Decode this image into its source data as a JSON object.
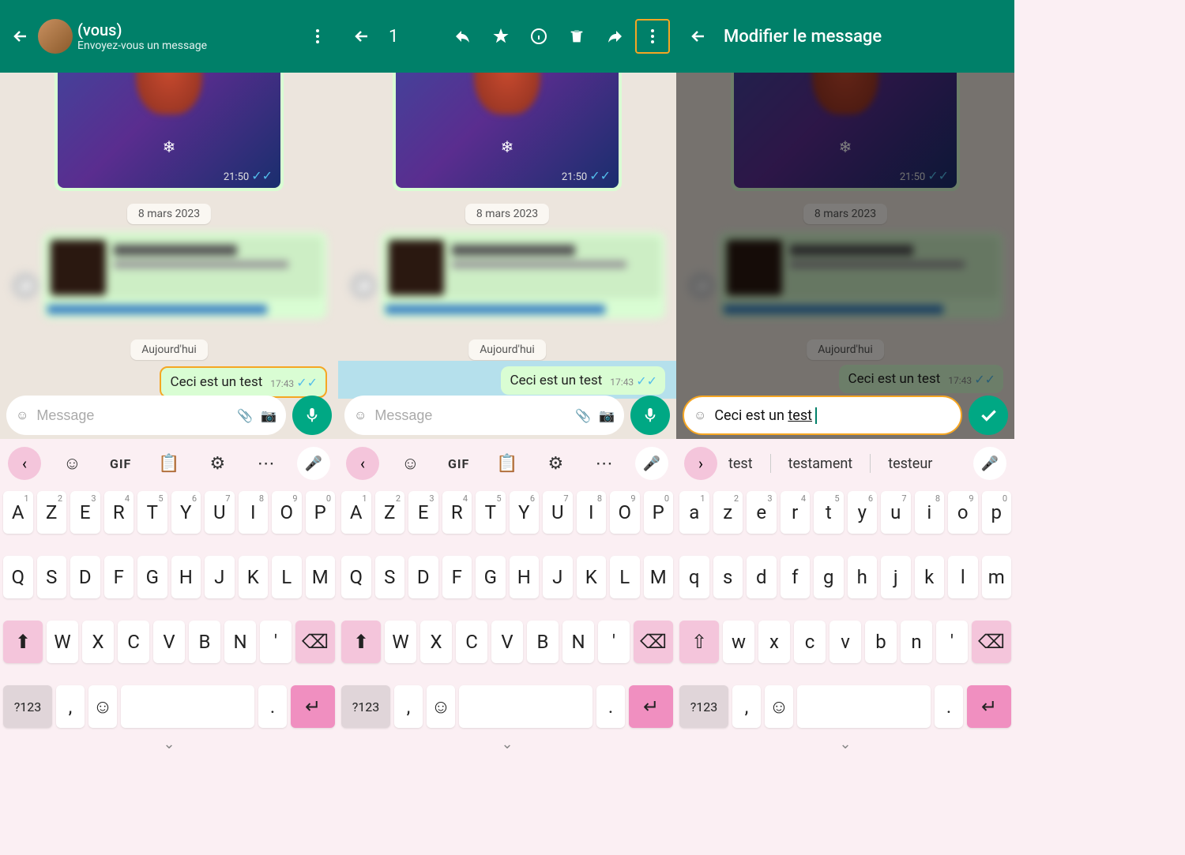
{
  "panel1": {
    "contact_suffix": "(vous)",
    "subtitle": "Envoyez-vous un message",
    "photo_time": "21:50",
    "date1": "8 mars 2023",
    "date2": "Aujourd'hui",
    "msg_text": "Ceci est un test",
    "msg_time": "17:43",
    "input_placeholder": "Message"
  },
  "panel2": {
    "sel_count": "1",
    "photo_time": "21:50",
    "date1": "8 mars 2023",
    "date2": "Aujourd'hui",
    "msg_text": "Ceci est un test",
    "msg_time": "17:43",
    "input_placeholder": "Message"
  },
  "panel3": {
    "edit_title": "Modifier le message",
    "photo_time": "21:50",
    "date1": "8 mars 2023",
    "date2": "Aujourd'hui",
    "msg_text": "Ceci est un test",
    "msg_time": "17:43",
    "edit_prefix": "Ceci est un ",
    "edit_under": "test",
    "suggestions": [
      "test",
      "testament",
      "testeur"
    ]
  },
  "keyboard_upper": {
    "row1": [
      "A",
      "Z",
      "E",
      "R",
      "T",
      "Y",
      "U",
      "I",
      "O",
      "P"
    ],
    "row1_sup": [
      "1",
      "2",
      "3",
      "4",
      "5",
      "6",
      "7",
      "8",
      "9",
      "0"
    ],
    "row2": [
      "Q",
      "S",
      "D",
      "F",
      "G",
      "H",
      "J",
      "K",
      "L",
      "M"
    ],
    "row3": [
      "W",
      "X",
      "C",
      "V",
      "B",
      "N",
      "'"
    ],
    "num_label": "?123",
    "gif": "GIF"
  },
  "keyboard_lower": {
    "row1": [
      "a",
      "z",
      "e",
      "r",
      "t",
      "y",
      "u",
      "i",
      "o",
      "p"
    ],
    "row1_sup": [
      "1",
      "2",
      "3",
      "4",
      "5",
      "6",
      "7",
      "8",
      "9",
      "0"
    ],
    "row2": [
      "q",
      "s",
      "d",
      "f",
      "g",
      "h",
      "j",
      "k",
      "l",
      "m"
    ],
    "row3": [
      "w",
      "x",
      "c",
      "v",
      "b",
      "n",
      "'"
    ],
    "num_label": "?123"
  }
}
